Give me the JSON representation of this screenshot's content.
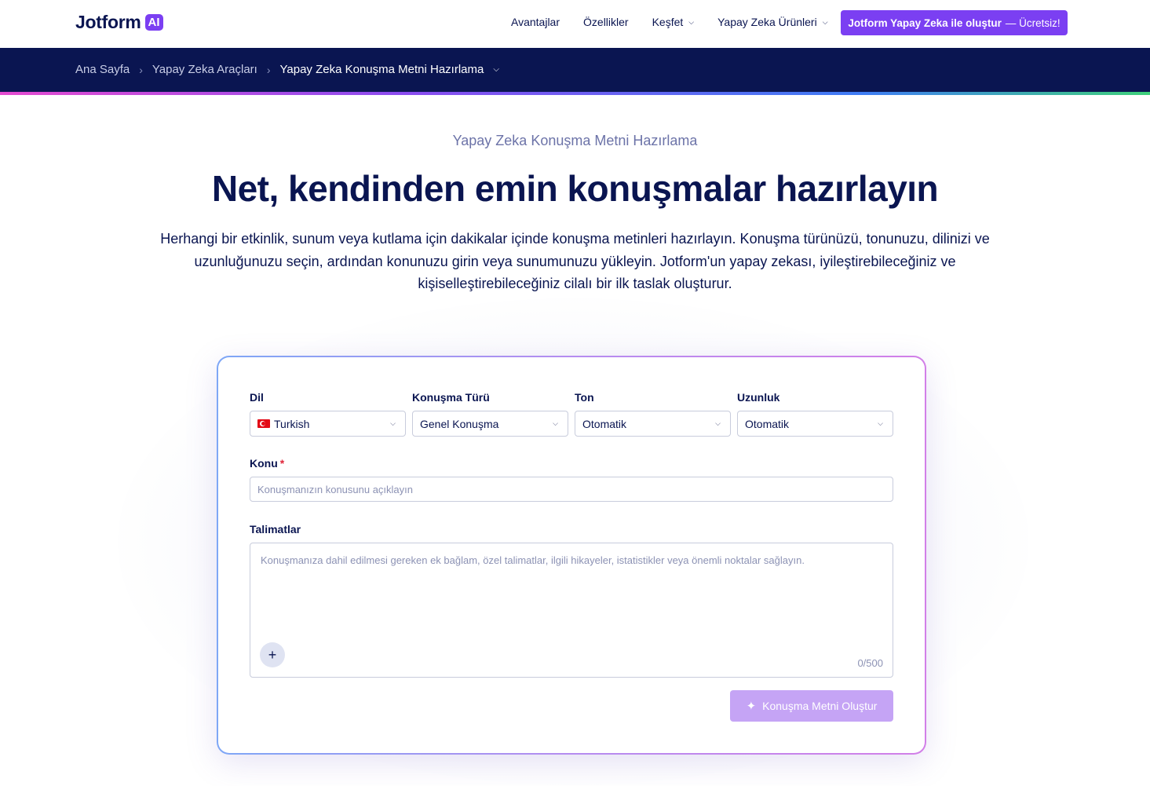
{
  "brand": {
    "name": "Jotform",
    "badge": "AI",
    "accent": "#7b3ff2",
    "navy": "#0a1551"
  },
  "nav": {
    "links": [
      {
        "label": "Avantajlar",
        "dropdown": false
      },
      {
        "label": "Özellikler",
        "dropdown": false
      },
      {
        "label": "Keşfet",
        "dropdown": true
      },
      {
        "label": "Yapay Zeka Ürünleri",
        "dropdown": true
      }
    ],
    "cta_bold": "Jotform Yapay Zeka ile oluştur",
    "cta_free": "— Ücretsiz!"
  },
  "breadcrumb": {
    "items": [
      "Ana Sayfa",
      "Yapay Zeka Araçları"
    ],
    "current": "Yapay Zeka Konuşma Metni Hazırlama"
  },
  "hero": {
    "eyebrow": "Yapay Zeka Konuşma Metni Hazırlama",
    "title": "Net, kendinden emin konuşmalar hazırlayın",
    "description": "Herhangi bir etkinlik, sunum veya kutlama için dakikalar içinde konuşma metinleri hazırlayın. Konuşma türünüzü, tonunuzu, dilinizi ve uzunluğunuzu seçin, ardından konunuzu girin veya sunumunuzu yükleyin. Jotform'un yapay zekası, iyileştirebileceğiniz ve kişiselleştirebileceğiniz cilalı bir ilk taslak oluşturur."
  },
  "form": {
    "language": {
      "label": "Dil",
      "value": "Turkish",
      "icon": "turkey-flag-icon"
    },
    "speech_type": {
      "label": "Konuşma Türü",
      "value": "Genel Konuşma"
    },
    "tone": {
      "label": "Ton",
      "value": "Otomatik"
    },
    "length": {
      "label": "Uzunluk",
      "value": "Otomatik"
    },
    "topic": {
      "label": "Konu",
      "required_mark": "*",
      "value": "",
      "placeholder": "Konuşmanızın konusunu açıklayın"
    },
    "instructions": {
      "label": "Talimatlar",
      "value": "",
      "placeholder": "Konuşmanıza dahil edilmesi gereken ek bağlam, özel talimatlar, ilgili hikayeler, istatistikler veya önemli noktalar sağlayın.",
      "counter": "0/500",
      "add_icon": "plus-icon"
    },
    "submit_label": "Konuşma Metni Oluştur",
    "submit_icon": "sparkle-icon"
  }
}
